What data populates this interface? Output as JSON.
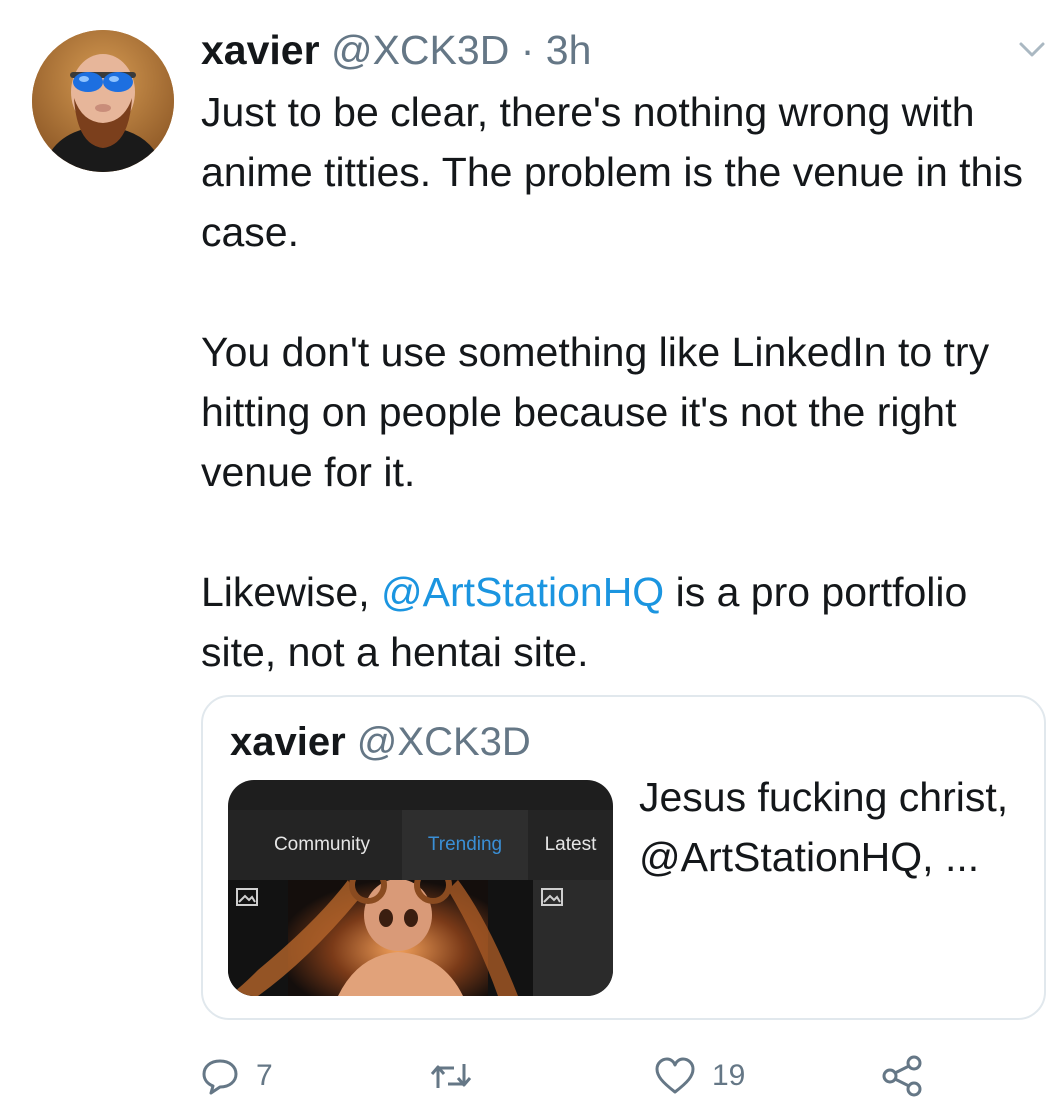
{
  "tweet": {
    "display_name": "xavier",
    "handle": "@XCK3D",
    "separator": "·",
    "time": "3h",
    "paragraph1": "Just to be clear, there's nothing wrong with anime titties. The problem is the venue in this case.",
    "paragraph2": "You don't use something like LinkedIn to try hitting on people because it's not the right venue for it.",
    "paragraph3_prefix": "Likewise,",
    "paragraph3_mention": "@ArtStationHQ",
    "paragraph3_suffix": "is a pro portfolio site, not a hentai site."
  },
  "quote": {
    "display_name": "xavier",
    "handle": "@XCK3D",
    "text": "Jesus fucking christ, @ArtStationHQ, ...",
    "image_tabs": [
      "Community",
      "Trending",
      "Latest"
    ],
    "active_tab_color": "#3a8fd6"
  },
  "actions": {
    "reply_count": "7",
    "retweet_count": "",
    "like_count": "19",
    "icons": [
      "reply-icon",
      "retweet-icon",
      "like-icon",
      "share-icon"
    ]
  },
  "colors": {
    "text": "#14171a",
    "secondary": "#657786",
    "link": "#1b95e0",
    "border": "#e1e8ed"
  }
}
